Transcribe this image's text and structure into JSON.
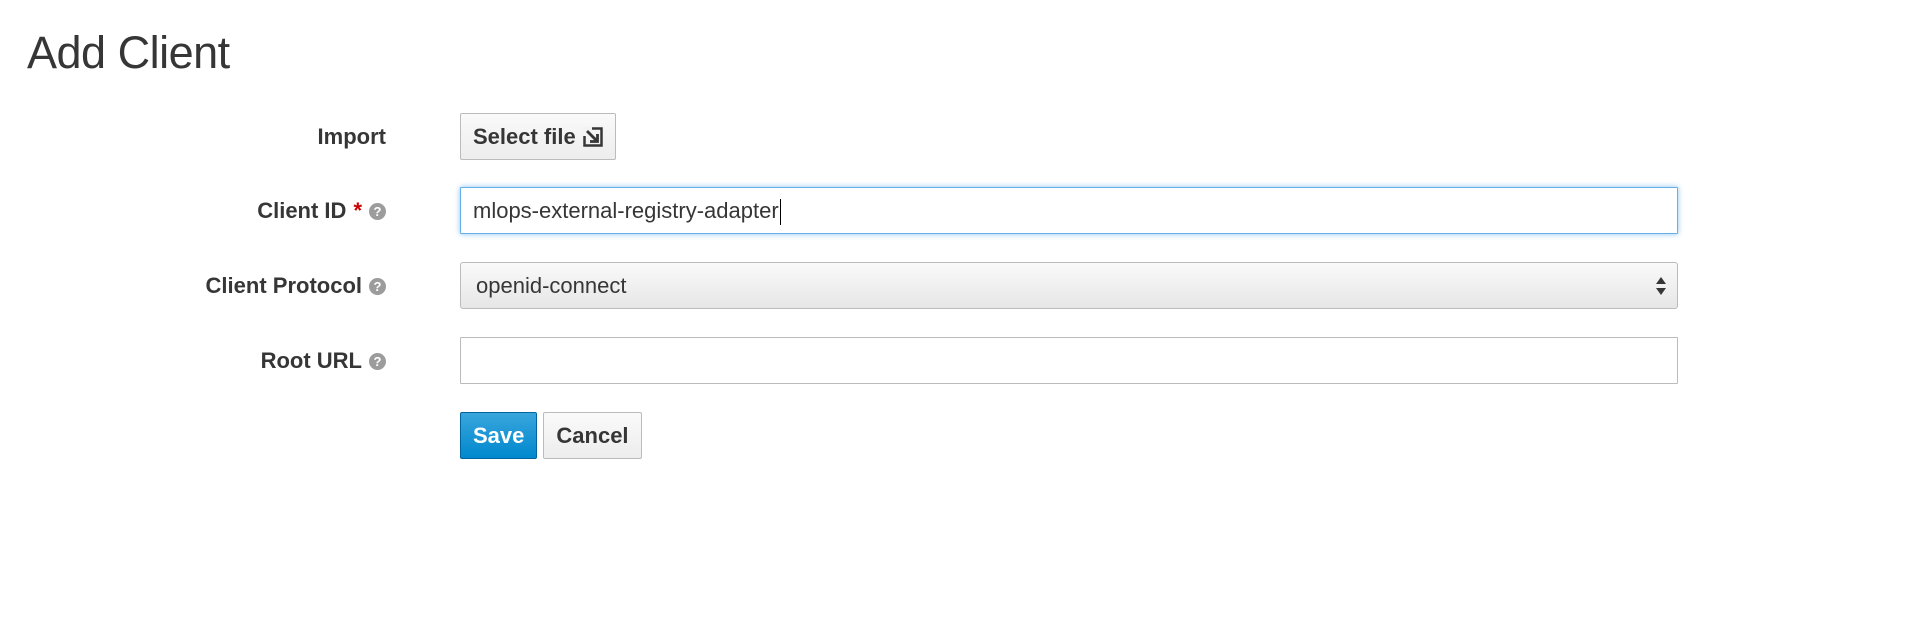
{
  "page": {
    "title": "Add Client"
  },
  "form": {
    "import": {
      "label": "Import",
      "button_label": "Select file",
      "icon": "import-icon"
    },
    "client_id": {
      "label": "Client ID",
      "required_mark": "*",
      "help_icon": "question-circle-icon",
      "value": "mlops-external-registry-adapter",
      "focused": true
    },
    "client_protocol": {
      "label": "Client Protocol",
      "help_icon": "question-circle-icon",
      "selected": "openid-connect"
    },
    "root_url": {
      "label": "Root URL",
      "help_icon": "question-circle-icon",
      "value": ""
    },
    "actions": {
      "save_label": "Save",
      "cancel_label": "Cancel"
    }
  },
  "colors": {
    "primary": "#0088ce",
    "required": "#cc0000",
    "focus": "#66afe9",
    "text": "#363636"
  }
}
